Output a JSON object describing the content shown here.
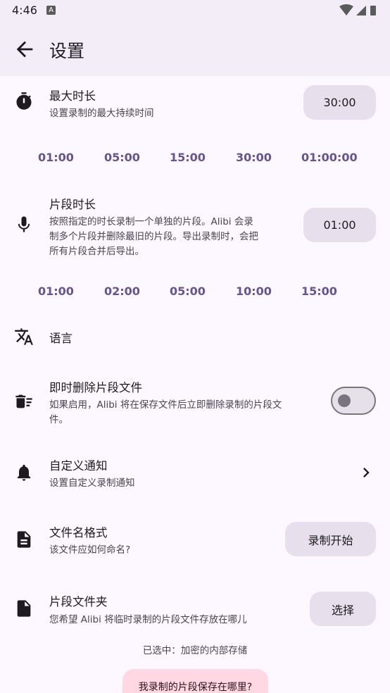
{
  "status_bar": {
    "time": "4:46",
    "notif_badge": "A"
  },
  "header": {
    "title": "设置"
  },
  "max_duration": {
    "title": "最大时长",
    "subtitle": "设置录制的最大持续时间",
    "value": "30:00",
    "presets": [
      "01:00",
      "05:00",
      "15:00",
      "30:00",
      "01:00:00"
    ]
  },
  "segment_duration": {
    "title": "片段时长",
    "subtitle_lines": [
      "按照指定的时长录制一个单独的片段。Alibi 会录",
      "制多个片段并删除最旧的片段。导出录制时，会把",
      "所有片段合并后导出。"
    ],
    "value": "01:00",
    "presets": [
      "01:00",
      "02:00",
      "05:00",
      "10:00",
      "15:00"
    ]
  },
  "language": {
    "title": "语言"
  },
  "delete_segments": {
    "title": "即时删除片段文件",
    "subtitle_lines": [
      "如果启用，Alibi 将在保存文件后立即删除录制的片段文",
      "件。"
    ],
    "enabled": false
  },
  "custom_notification": {
    "title": "自定义通知",
    "subtitle": "设置自定义录制通知"
  },
  "filename_format": {
    "title": "文件名格式",
    "subtitle": "该文件应如何命名?",
    "value": "录制开始"
  },
  "segment_folder": {
    "title": "片段文件夹",
    "subtitle": "您希望 Alibi 将临时录制的片段文件存放在哪儿",
    "button": "选择",
    "selected": "已选中：加密的内部存储"
  },
  "help_button": "我录制的片段保存在哪里?"
}
